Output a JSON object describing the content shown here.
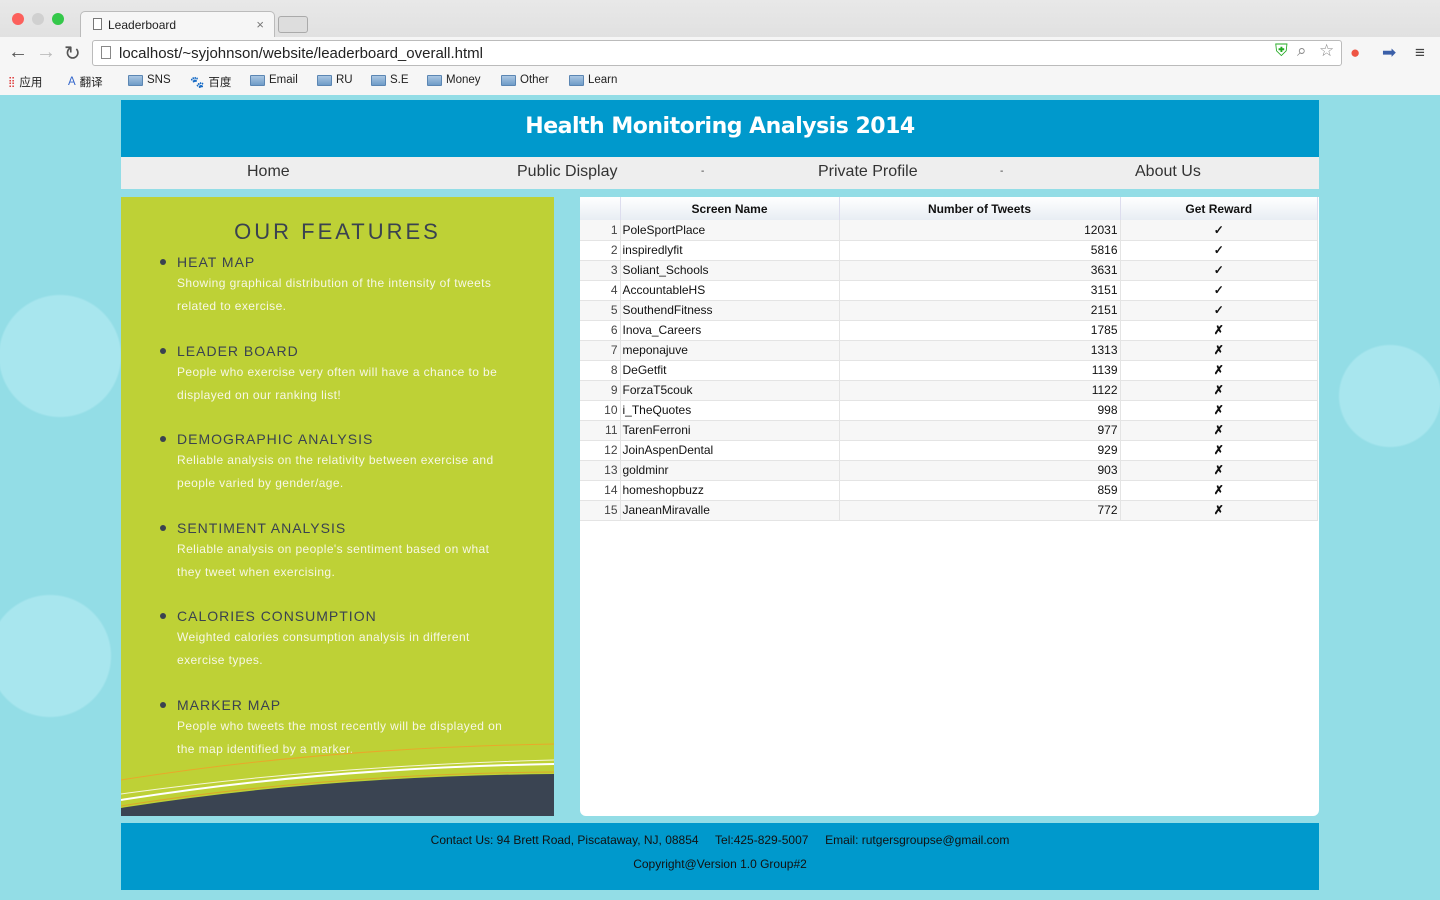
{
  "browser": {
    "tab_title": "Leaderboard",
    "url": "localhost/~syjohnson/website/leaderboard_overall.html",
    "bookmarks": [
      "应用",
      "翻译",
      "SNS",
      "百度",
      "Email",
      "RU",
      "S.E",
      "Money",
      "Other",
      "Learn"
    ]
  },
  "header": {
    "title": "Health Monitoring Analysis 2014"
  },
  "menu": {
    "items": [
      "Home",
      "Public Display",
      "Private Profile",
      "About Us"
    ],
    "separator": "-"
  },
  "features": {
    "title": "OUR FEATURES",
    "items": [
      {
        "title": "HEAT MAP",
        "desc": "Showing graphical distribution of the intensity of tweets related to exercise."
      },
      {
        "title": "LEADER BOARD",
        "desc": "People who exercise very often will have a chance to be displayed on our ranking list!"
      },
      {
        "title": "DEMOGRAPHIC ANALYSIS",
        "desc": "Reliable analysis on the relativity between exercise and people varied by gender/age."
      },
      {
        "title": "SENTIMENT ANALYSIS",
        "desc": "Reliable analysis on people's sentiment based on what they tweet when exercising."
      },
      {
        "title": "CALORIES CONSUMPTION",
        "desc": "Weighted calories consumption analysis in different exercise types."
      },
      {
        "title": "MARKER MAP",
        "desc": "People who tweets the most recently will be displayed on the map identified by a marker."
      }
    ]
  },
  "leaderboard": {
    "columns": [
      "",
      "Screen Name",
      "Number of Tweets",
      "Get Reward"
    ],
    "rows": [
      [
        "1",
        "PoleSportPlace",
        "12031",
        "✓"
      ],
      [
        "2",
        "inspiredlyfit",
        "5816",
        "✓"
      ],
      [
        "3",
        "Soliant_Schools",
        "3631",
        "✓"
      ],
      [
        "4",
        "AccountableHS",
        "3151",
        "✓"
      ],
      [
        "5",
        "SouthendFitness",
        "2151",
        "✓"
      ],
      [
        "6",
        "Inova_Careers",
        "1785",
        "✗"
      ],
      [
        "7",
        "meponajuve",
        "1313",
        "✗"
      ],
      [
        "8",
        "DeGetfit",
        "1139",
        "✗"
      ],
      [
        "9",
        "ForzaT5couk",
        "1122",
        "✗"
      ],
      [
        "10",
        "i_TheQuotes",
        "998",
        "✗"
      ],
      [
        "11",
        "TarenFerroni",
        "977",
        "✗"
      ],
      [
        "12",
        "JoinAspenDental",
        "929",
        "✗"
      ],
      [
        "13",
        "goldminr",
        "903",
        "✗"
      ],
      [
        "14",
        "homeshopbuzz",
        "859",
        "✗"
      ],
      [
        "15",
        "JaneanMiravalle",
        "772",
        "✗"
      ]
    ]
  },
  "footer": {
    "contact": "Contact Us: 94 Brett Road, Piscataway, NJ, 08854     Tel:425-829-5007     Email: rutgersgroupse@gmail.com",
    "copyright": "Copyright@Version 1.0 Group#2"
  },
  "colors": {
    "header": "#0099cc",
    "features": "#bed136",
    "background": "#93dde6"
  }
}
